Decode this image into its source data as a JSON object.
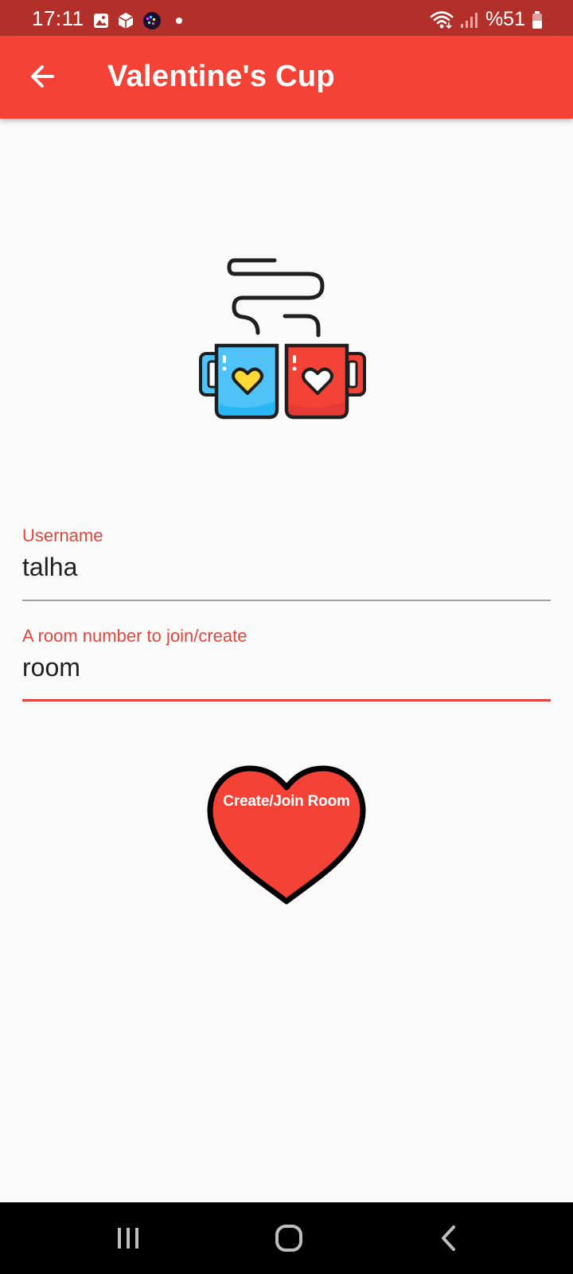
{
  "status_bar": {
    "time": "17:11",
    "battery": "%51",
    "icons": [
      "gallery-icon",
      "package-icon",
      "game-icon",
      "notification-dot",
      "wifi-icon",
      "signal-icon",
      "battery-icon"
    ]
  },
  "app_bar": {
    "title": "Valentine's Cup",
    "back_icon": "arrow-back-icon"
  },
  "logo": {
    "icon": "coffee-cups-hearts-logo",
    "colors": {
      "left_cup": "#4fc3f7",
      "right_cup": "#f44336",
      "left_heart": "#fdd835",
      "right_heart": "#ffffff"
    }
  },
  "form": {
    "username": {
      "label": "Username",
      "value": "talha"
    },
    "room": {
      "label": "A room number to join/create",
      "value": "room"
    }
  },
  "action_button": {
    "label": "Create/Join Room",
    "shape": "heart-icon"
  },
  "nav_bar": {
    "buttons": [
      "recents-icon",
      "home-icon",
      "back-icon"
    ]
  },
  "colors": {
    "status_bar": "#b3302a",
    "primary": "#f44336",
    "accent_text": "#e2453c",
    "background": "#fafafa"
  }
}
